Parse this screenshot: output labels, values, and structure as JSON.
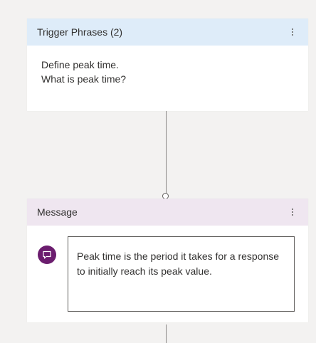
{
  "trigger_card": {
    "title": "Trigger Phrases (2)",
    "phrases": [
      "Define peak time.",
      "What is peak time?"
    ],
    "header_color": "#deecf9"
  },
  "message_card": {
    "title": "Message",
    "text": "Peak time is the period it takes for a response to initially reach its peak value.",
    "header_color": "#efe6f0",
    "icon": "chat-bubble-icon",
    "icon_color": "#6b1d6e"
  }
}
